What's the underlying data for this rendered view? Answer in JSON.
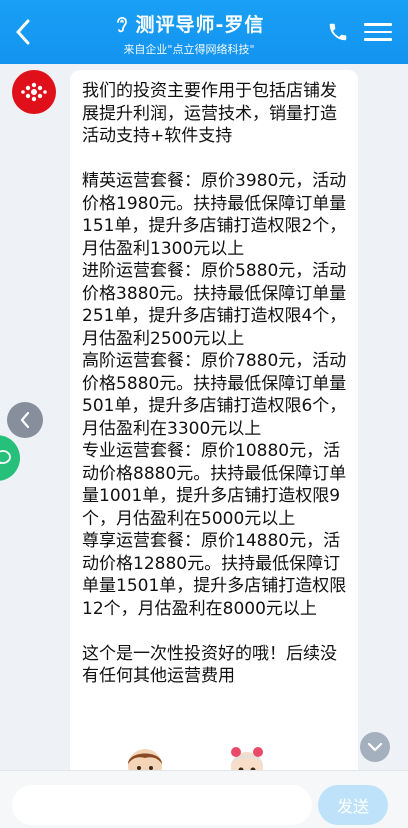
{
  "header": {
    "title": "测评导师-罗信",
    "subtitle": "来自企业\"点立得网络科技\"",
    "title_icon": "ear-icon",
    "back_icon": "chevron-left-icon",
    "phone_icon": "phone-icon",
    "menu_icon": "hamburger-menu-icon",
    "bg_color": "#1393f0"
  },
  "chat": {
    "avatar_icon": "red-flower-logo",
    "message": "我们的投资主要作用于包括店铺发展提升利润，运营技术，销量打造活动支持+软件支持\n\n精英运营套餐：原价3980元，活动价格1980元。扶持最低保障订单量151单，提升多店铺打造权限2个，月估盈利1300元以上\n进阶运营套餐：原价5880元，活动价格3880元。扶持最低保障订单量251单，提升多店铺打造权限4个，月估盈利2500元以上\n高阶运营套餐：原价7880元，活动价格5880元。扶持最低保障订单量501单，提升多店铺打造权限6个，月估盈利在3300元以上\n专业运营套餐：原价10880元，活动价格8880元。扶持最低保障订单量1001单，提升多店铺打造权限9个，月估盈利在5000元以上\n尊享运营套餐：原价14880元，活动价格12880元。扶持最低保障订单量1501单，提升多店铺打造权限12个，月估盈利在8000元以上\n\n这个是一次性投资好的哦！后续没有任何其他运营费用"
  },
  "widgets": {
    "float_left_icon": "chevron-left-icon",
    "side_icon": "chat-bubble-icon",
    "scroll_down_icon": "chevron-down-icon",
    "mascot_left": "boy-mascot-icon",
    "mascot_right": "girl-mascot-icon"
  },
  "input": {
    "value": "",
    "placeholder": "",
    "send_label": "发送"
  }
}
